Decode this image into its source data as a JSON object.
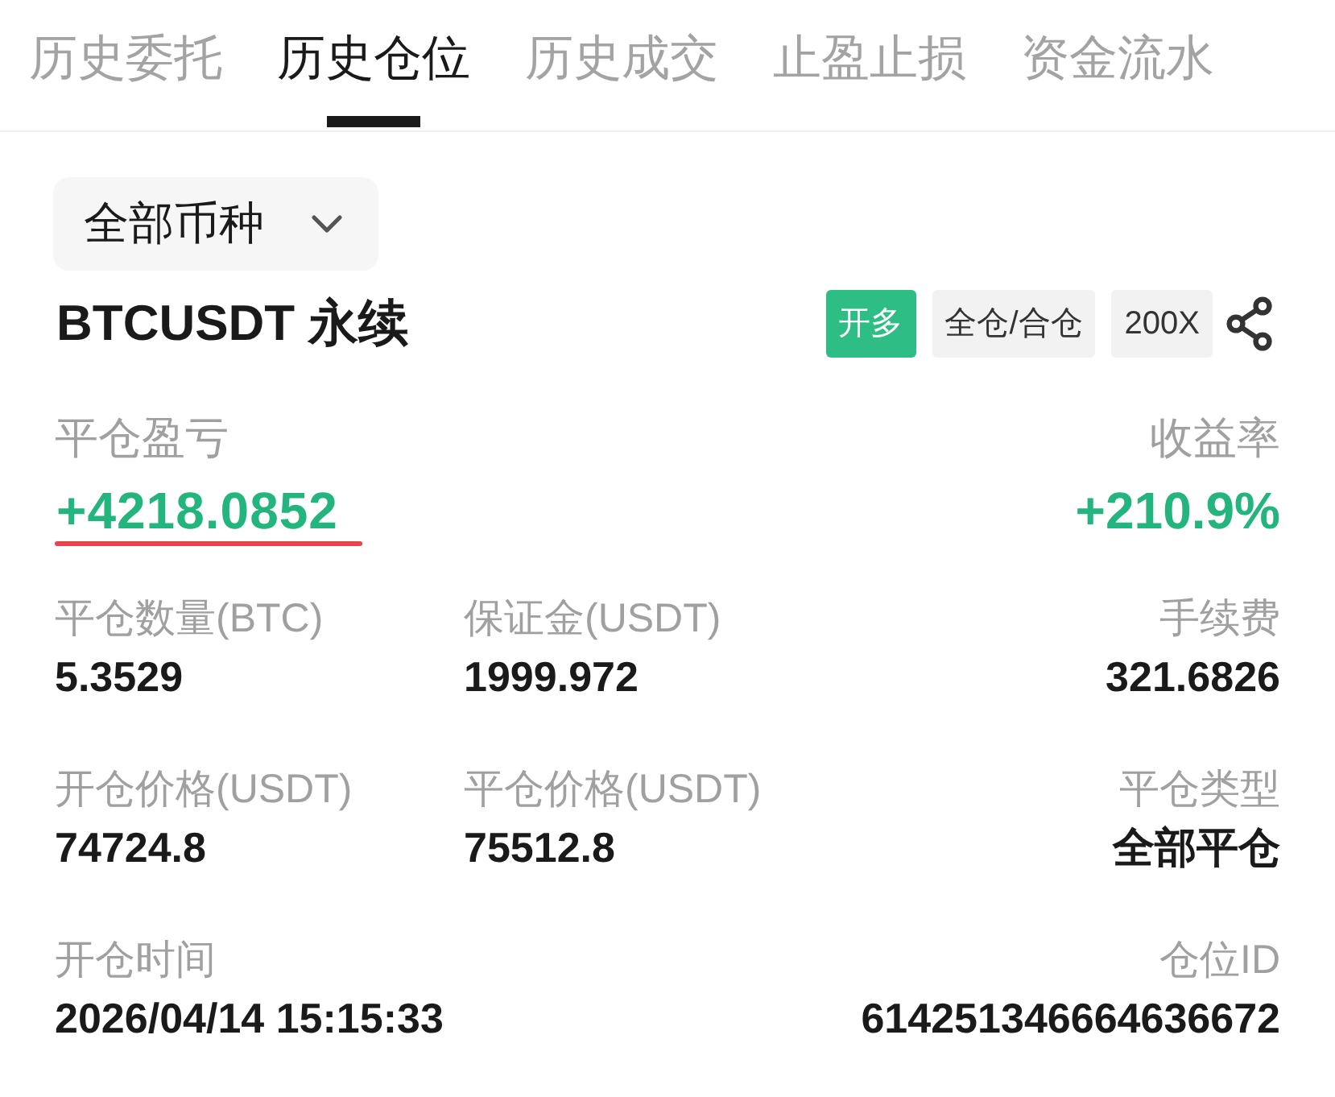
{
  "tabs": [
    {
      "label": "历史委托",
      "selected": false
    },
    {
      "label": "历史仓位",
      "selected": true
    },
    {
      "label": "历史成交",
      "selected": false
    },
    {
      "label": "止盈止损",
      "selected": false
    },
    {
      "label": "资金流水",
      "selected": false
    }
  ],
  "filter": {
    "label": "全部币种"
  },
  "position": {
    "symbol": "BTCUSDT 永续",
    "tags": [
      {
        "kind": "side",
        "label": "开多"
      },
      {
        "kind": "plain",
        "label": "全仓/合仓"
      },
      {
        "kind": "plain",
        "label": "200X"
      }
    ]
  },
  "summary": {
    "pnl": {
      "label": "平仓盈亏",
      "value": "+4218.0852",
      "underlined": true
    },
    "return_rate": {
      "label": "收益率",
      "value": "+210.9%"
    }
  },
  "details": [
    {
      "left": {
        "label": "平仓数量(BTC)",
        "value": "5.3529"
      },
      "middle": {
        "label": "保证金(USDT)",
        "value": "1999.972"
      },
      "right": {
        "label": "手续费",
        "value": "321.6826"
      }
    },
    {
      "left": {
        "label": "开仓价格(USDT)",
        "value": "74724.8"
      },
      "middle": {
        "label": "平仓价格(USDT)",
        "value": "75512.8"
      },
      "right": {
        "label": "平仓类型",
        "value": "全部平仓"
      }
    },
    {
      "left": {
        "label": "开仓时间",
        "value": "2026/04/14 15:15:33"
      },
      "right": {
        "label": "仓位ID",
        "value": "614251346664636672"
      }
    }
  ]
}
